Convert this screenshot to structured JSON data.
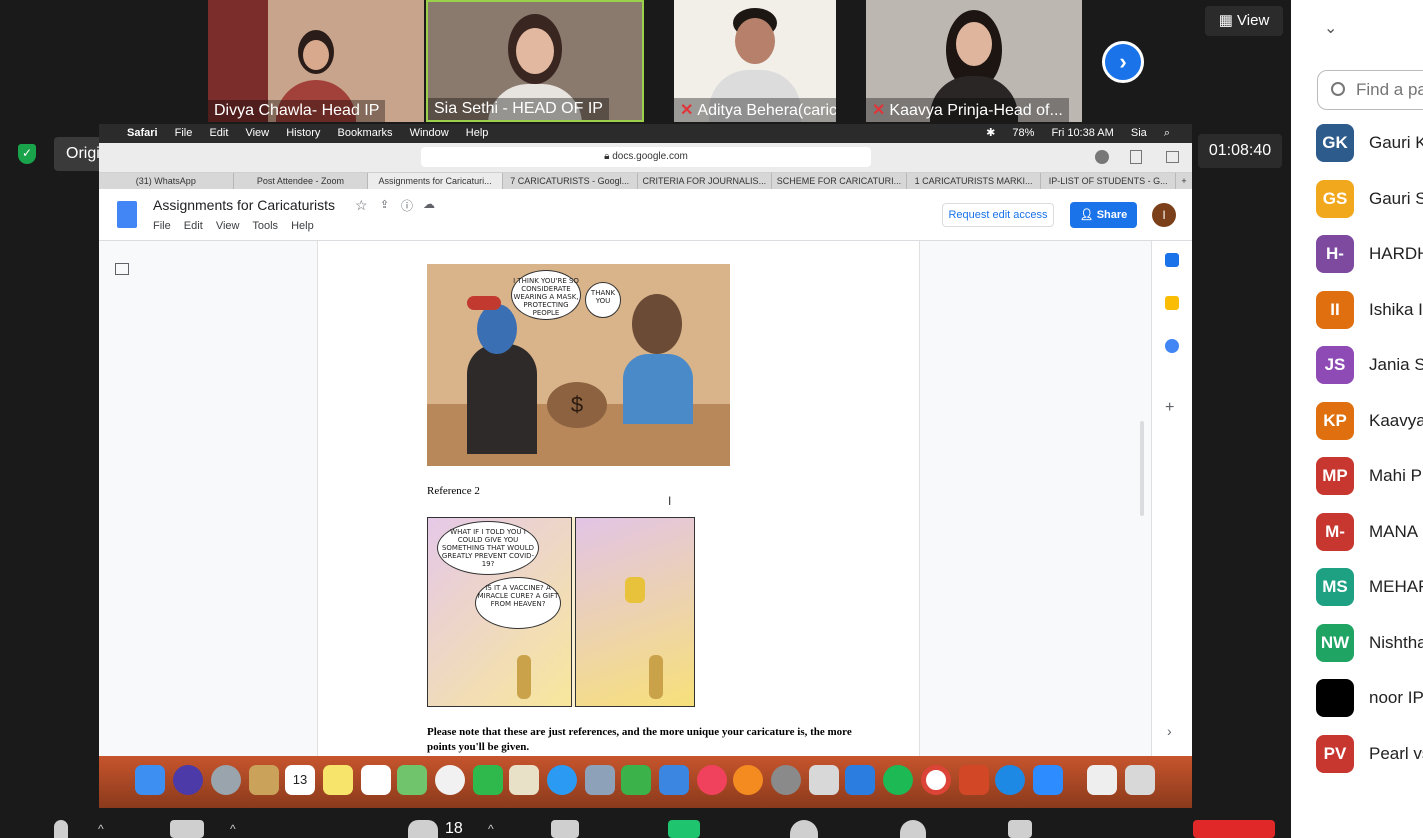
{
  "video_tiles": [
    {
      "name": "Divya Chawla- Head IP",
      "muted": false,
      "bg": "#c9a48c"
    },
    {
      "name": "Sia Sethi - HEAD OF IP",
      "muted": false,
      "bg": "#8a7a6e"
    },
    {
      "name": "Aditya Behera(caricatu...",
      "muted": true,
      "bg": "#f2efe9"
    },
    {
      "name": "Kaavya Prinja-Head of...",
      "muted": true,
      "bg": "#bdb7b2"
    }
  ],
  "view_label": "View",
  "original_sound": "Original Sound: Off",
  "timer": "01:08:40",
  "mac_menubar": {
    "app_items": [
      "Safari",
      "File",
      "Edit",
      "View",
      "History",
      "Bookmarks",
      "Window",
      "Help"
    ],
    "battery": "78%",
    "clock": "Fri 10:38 AM",
    "user": "Sia"
  },
  "browser": {
    "url": "docs.google.com",
    "tabs": [
      "(31) WhatsApp",
      "Post Attendee - Zoom",
      "Assignments for Caricaturi...",
      "7 CARICATURISTS - Googl...",
      "CRITERIA FOR JOURNALIS...",
      "SCHEME FOR CARICATURI...",
      "1 CARICATURISTS MARKI...",
      "IP-LIST OF STUDENTS - G..."
    ]
  },
  "doc": {
    "title": "Assignments for Caricaturists",
    "menus": [
      "File",
      "Edit",
      "View",
      "Tools",
      "Help"
    ],
    "request_edit": "Request edit access",
    "share": "Share",
    "user_initial": "I",
    "reference_label": "Reference 2",
    "note": "Please note that these are just references, and the more unique your caricature is, the more points you'll be given.",
    "cartoon1_bubbles": [
      "I THINK YOU'RE SO CONSIDERATE WEARING A MASK, PROTECTING PEOPLE",
      "THANK YOU"
    ],
    "cartoon2_bubbles": [
      "WHAT IF I TOLD YOU I COULD GIVE YOU SOMETHING THAT WOULD GREATLY PREVENT COVID-19?",
      "IS IT A VACCINE? A MIRACLE CURE? A GIFT FROM HEAVEN?"
    ],
    "calendar_day": "13"
  },
  "toolbar": {
    "participants_count": "18"
  },
  "participants": [
    {
      "initials": "GK",
      "name": "Gauri K",
      "color": "#2d5b8c"
    },
    {
      "initials": "GS",
      "name": "Gauri S",
      "color": "#f2a81d"
    },
    {
      "initials": "H-",
      "name": "HARDH",
      "color": "#7d4aa0"
    },
    {
      "initials": "II",
      "name": "Ishika I",
      "color": "#e0700f"
    },
    {
      "initials": "JS",
      "name": "Jania S",
      "color": "#8e4bb5"
    },
    {
      "initials": "KP",
      "name": "Kaavya",
      "color": "#e0700f"
    },
    {
      "initials": "MP",
      "name": "Mahi P",
      "color": "#c7372f"
    },
    {
      "initials": "M-",
      "name": "MANA",
      "color": "#c7372f"
    },
    {
      "initials": "MS",
      "name": "MEHAR",
      "color": "#1ea083"
    },
    {
      "initials": "NW",
      "name": "Nishtha",
      "color": "#1fa463"
    },
    {
      "initials": "",
      "name": "noor IP",
      "color": "#000000"
    },
    {
      "initials": "PV",
      "name": "Pearl vs",
      "color": "#c7372f"
    }
  ]
}
